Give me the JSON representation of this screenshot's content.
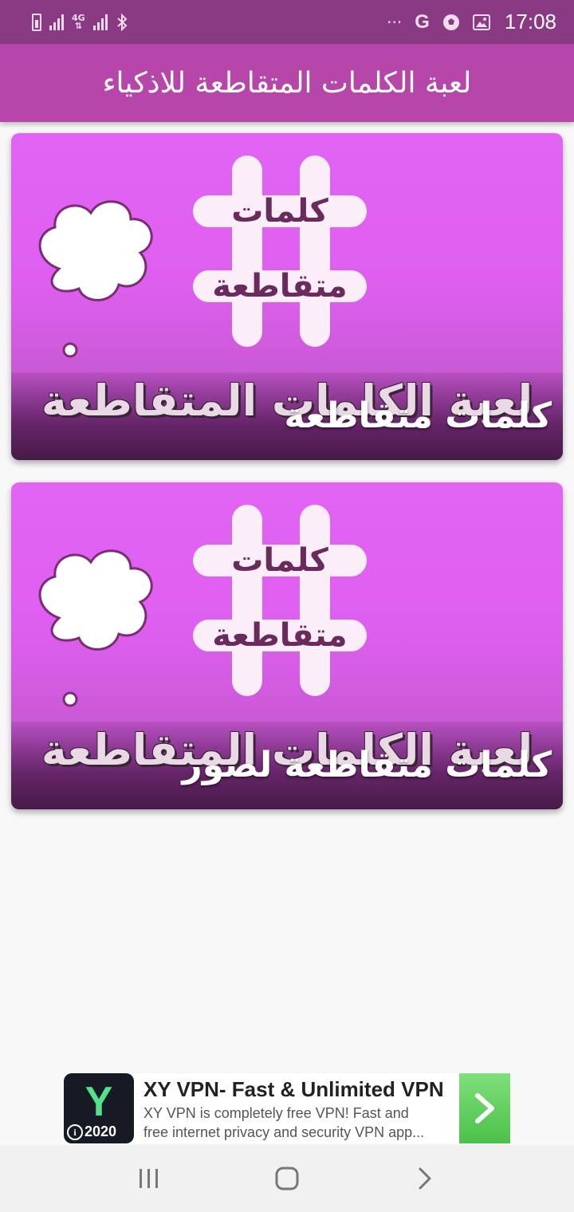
{
  "status_bar": {
    "network": "4G",
    "time": "17:08",
    "overflow": "···",
    "google_letter": "G",
    "icons": [
      "battery-icon",
      "signal-icon",
      "bluetooth-icon",
      "more-icon",
      "google-icon",
      "soccer-ball-icon",
      "gallery-icon"
    ]
  },
  "app_bar": {
    "title": "لعبة الكلمات المتقاطعة للاذكياء"
  },
  "cards": [
    {
      "art_word_top": "كلمات",
      "art_word_bottom": "متقاطعة",
      "banner": "لعبة الكلمات المتقاطعة",
      "label": "كلمات متقاطعة"
    },
    {
      "art_word_top": "كلمات",
      "art_word_bottom": "متقاطعة",
      "banner": "لعبة الكلمات المتقاطعة",
      "label": "كلمات متقاطعة لصور"
    }
  ],
  "ad": {
    "logo_letter": "Y",
    "logo_year": "2020",
    "info_glyph": "i",
    "title": "XY VPN- Fast & Unlimited VPN",
    "description_line1": "XY VPN is completely free VPN! Fast and",
    "description_line2": "free internet privacy and security VPN app...",
    "accent": "#53e28a",
    "cta_color": "#5ccb57"
  },
  "nav_bar": {
    "icons": [
      "recents-icon",
      "home-icon",
      "back-icon"
    ]
  },
  "colors": {
    "status_bar": "#8a3a82",
    "app_bar": "#b746aa",
    "card_pink": "#e264f4"
  }
}
